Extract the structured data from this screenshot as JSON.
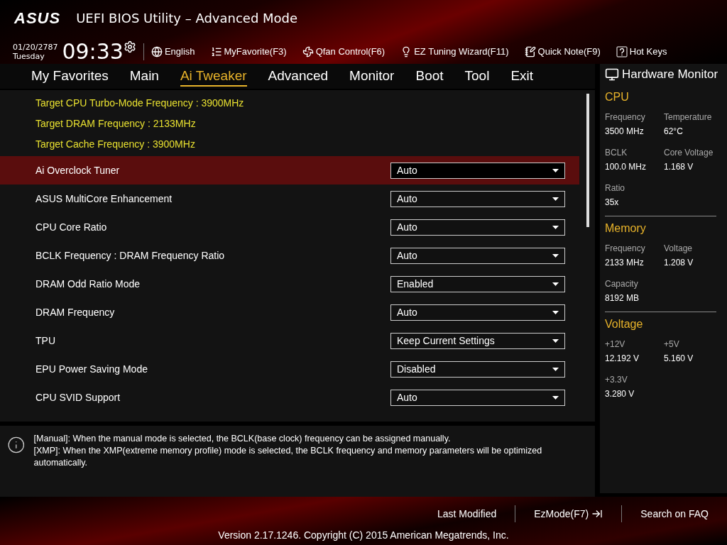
{
  "header": {
    "logo": "ASUS",
    "title": "UEFI BIOS Utility – Advanced Mode",
    "date": "01/20/2787",
    "day": "Tuesday",
    "time": "09:33",
    "tools": [
      {
        "kind": "language",
        "label": "English"
      },
      {
        "kind": "favorite",
        "label": "MyFavorite(F3)"
      },
      {
        "kind": "fan",
        "label": "Qfan Control(F6)"
      },
      {
        "kind": "wizard",
        "label": "EZ Tuning Wizard(F11)"
      },
      {
        "kind": "note",
        "label": "Quick Note(F9)"
      },
      {
        "kind": "hotkeys",
        "label": "Hot Keys"
      }
    ]
  },
  "tabs": [
    {
      "label": "My Favorites",
      "selected": false
    },
    {
      "label": "Main",
      "selected": false
    },
    {
      "label": "Ai Tweaker",
      "selected": true
    },
    {
      "label": "Advanced",
      "selected": false
    },
    {
      "label": "Monitor",
      "selected": false
    },
    {
      "label": "Boot",
      "selected": false
    },
    {
      "label": "Tool",
      "selected": false
    },
    {
      "label": "Exit",
      "selected": false
    }
  ],
  "info_lines": [
    "Target CPU Turbo-Mode Frequency : 3900MHz",
    "Target DRAM Frequency : 2133MHz",
    "Target Cache Frequency : 3900MHz"
  ],
  "settings": [
    {
      "label": "Ai Overclock Tuner",
      "value": "Auto",
      "selected": true
    },
    {
      "label": "ASUS MultiCore Enhancement",
      "value": "Auto",
      "selected": false
    },
    {
      "label": "CPU Core Ratio",
      "value": "Auto",
      "selected": false
    },
    {
      "label": "BCLK Frequency : DRAM Frequency Ratio",
      "value": "Auto",
      "selected": false
    },
    {
      "label": "DRAM Odd Ratio Mode",
      "value": "Enabled",
      "selected": false
    },
    {
      "label": "DRAM Frequency",
      "value": "Auto",
      "selected": false
    },
    {
      "label": "TPU",
      "value": "Keep Current Settings",
      "selected": false
    },
    {
      "label": "EPU Power Saving Mode",
      "value": "Disabled",
      "selected": false
    },
    {
      "label": "CPU SVID Support",
      "value": "Auto",
      "selected": false
    }
  ],
  "help": {
    "lines": [
      "[Manual]: When the manual mode is selected, the BCLK(base clock) frequency can be assigned manually.",
      "[XMP]: When the XMP(extreme memory profile) mode is selected, the BCLK frequency and memory parameters will be optimized automatically."
    ]
  },
  "hardware_monitor": {
    "title": "Hardware Monitor",
    "sections": [
      {
        "title": "CPU",
        "items": [
          {
            "label": "Frequency",
            "value": "3500 MHz"
          },
          {
            "label": "Temperature",
            "value": "62°C"
          },
          {
            "label": "BCLK",
            "value": "100.0 MHz"
          },
          {
            "label": "Core Voltage",
            "value": "1.168 V"
          },
          {
            "label": "Ratio",
            "value": "35x"
          }
        ]
      },
      {
        "title": "Memory",
        "items": [
          {
            "label": "Frequency",
            "value": "2133 MHz"
          },
          {
            "label": "Voltage",
            "value": "1.208 V"
          },
          {
            "label": "Capacity",
            "value": "8192 MB"
          }
        ]
      },
      {
        "title": "Voltage",
        "items": [
          {
            "label": "+12V",
            "value": "12.192 V"
          },
          {
            "label": "+5V",
            "value": "5.160 V"
          },
          {
            "label": "+3.3V",
            "value": "3.280 V"
          }
        ]
      }
    ]
  },
  "footer": {
    "actions": [
      {
        "kind": "text",
        "label": "Last Modified"
      },
      {
        "kind": "exit",
        "label": "EzMode(F7)"
      },
      {
        "kind": "text",
        "label": "Search on FAQ"
      }
    ],
    "copyright": "Version 2.17.1246. Copyright (C) 2015 American Megatrends, Inc."
  }
}
